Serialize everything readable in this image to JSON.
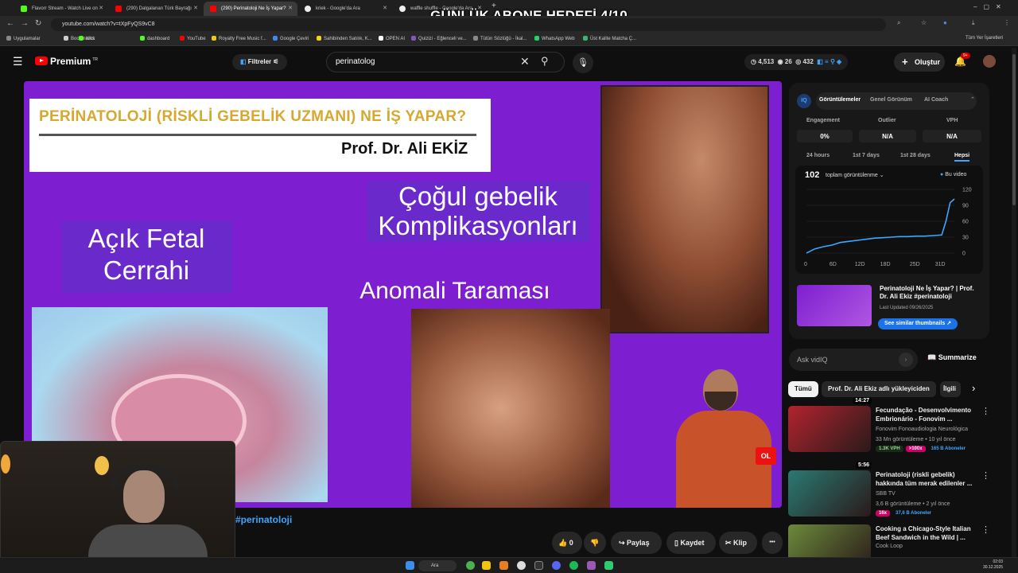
{
  "overlay": {
    "title": "GÜNLÜK ABONE HEDEFİ 4/10"
  },
  "browser": {
    "tabs": [
      {
        "label": "Flavorr Stream - Watch Live on",
        "color": "#53fc18"
      },
      {
        "label": "(290) Dalgalanan Türk Bayrağı",
        "color": "#ff0000"
      },
      {
        "label": "(290) Perinatoloji Ne İş Yapar?",
        "color": "#ff0000"
      },
      {
        "label": "kriek - Google'da Ara",
        "color": "#ffffff"
      },
      {
        "label": "waffle shuffle - Google'da Ara",
        "color": "#ffffff"
      }
    ],
    "new_tab": "+",
    "url": "youtube.com/watch?v=tXpFyQS9vC8",
    "bookmarks": [
      {
        "label": "Uygulamalar",
        "color": "#888888"
      },
      {
        "label": "Bookmarks",
        "color": "#cccccc"
      },
      {
        "label": "Kick",
        "color": "#53fc18"
      },
      {
        "label": "dashboard",
        "color": "#53fc18"
      },
      {
        "label": "YouTube",
        "color": "#ff0000"
      },
      {
        "label": "Royalty Free Music f...",
        "color": "#f5c518"
      },
      {
        "label": "Google Çeviri",
        "color": "#4285f4"
      },
      {
        "label": "Sahibinden Satılık, K...",
        "color": "#f5d60a"
      },
      {
        "label": "OPEN AI",
        "color": "#ffffff"
      },
      {
        "label": "Quizizi - Eğlenceli ve...",
        "color": "#8854c0"
      },
      {
        "label": "Tütün Sözlüğü - İkal...",
        "color": "#888888"
      },
      {
        "label": "WhatsApp Web",
        "color": "#25d366"
      },
      {
        "label": "Üst Kalite Matcha Ç...",
        "color": "#3cb371"
      }
    ],
    "other_bookmarks": "Tüm Yer İşaretleri"
  },
  "youtube": {
    "logo": "Premium",
    "logo_sup": "TR",
    "filters": "Filtreler",
    "search_value": "perinatolog",
    "stats": {
      "a": "4,513",
      "b": "26",
      "c": "432"
    },
    "create": "Oluştur",
    "notif_count": "9+"
  },
  "video": {
    "title_line1": "PERİNATOLOJİ (RİSKLİ GEBELİK UZMANI) NE İŞ YAPAR?",
    "title_line2": "Prof. Dr. Ali EKİZ",
    "label_fetal": "Açık Fetal\nCerrahi",
    "label_cogul": "Çoğul gebelik\nKomplikasyonları",
    "label_anomali": "Anomali Taraması",
    "abone_badge": "OL",
    "hashtag_link": "#perinatoloji",
    "actions": {
      "likes": "0",
      "share": "Paylaş",
      "save": "Kaydet",
      "clip": "Klip",
      "more": "•••"
    }
  },
  "vidiq": {
    "tabs": [
      "Görüntülemeler",
      "Genel Görünüm",
      "AI Coach"
    ],
    "metrics": [
      {
        "label": "Engagement",
        "value": "0%"
      },
      {
        "label": "Outlier",
        "value": "N/A"
      },
      {
        "label": "VPH",
        "value": "N/A"
      }
    ],
    "ranges": [
      "24 hours",
      "1st 7 days",
      "1st 28 days",
      "Hepsi"
    ],
    "views": "102",
    "views_select": "toplam görüntülenme",
    "legend": "Bu video",
    "rec_title": "Perinatoloji Ne İş Yapar? | Prof. Dr. Ali Ekiz #perinatoloji",
    "rec_updated": "Last Updated 09/26/2025",
    "similar_button": "See similar thumbnails",
    "ask_placeholder": "Ask vidIQ",
    "summarize": "Summarize",
    "accent": "#3ea6ff"
  },
  "chart_data": {
    "type": "line",
    "x": [
      0,
      2,
      4,
      6,
      8,
      10,
      12,
      14,
      16,
      18,
      20,
      22,
      24,
      26,
      28,
      30,
      32,
      33,
      34,
      35
    ],
    "x_unit": "days",
    "xticks": [
      "0",
      "6D",
      "12D",
      "18D",
      "25D",
      "31D"
    ],
    "yticks": [
      "0",
      "30",
      "60",
      "90",
      "120"
    ],
    "ylim": [
      0,
      120
    ],
    "series": [
      {
        "name": "Bu video",
        "values": [
          0,
          8,
          12,
          15,
          20,
          22,
          24,
          26,
          28,
          29,
          30,
          31,
          31,
          32,
          32,
          33,
          34,
          60,
          95,
          102
        ]
      }
    ]
  },
  "chips": [
    "Tümü",
    "Prof. Dr. Ali Ekiz adlı yükleyiciden",
    "İlgili"
  ],
  "recommendations": [
    {
      "title": "Fecundação - Desenvolvimento Embrionário - Fonovim ...",
      "channel": "Fonovim Fonoaudiologia Neurológica",
      "meta": "33 Mn görüntüleme • 10 yıl önce",
      "duration": "14:27",
      "badges": [
        {
          "text": "1.3K VPH",
          "bg": "#1a2a1a",
          "fg": "#8fd18f"
        },
        {
          "text": ">100x",
          "bg": "#cc0066",
          "fg": "#ffffff"
        },
        {
          "text": "165 B Aboneler",
          "bg": "transparent",
          "fg": "#3ea6ff"
        }
      ],
      "color": "#b3232f"
    },
    {
      "title": "Perinatoloji (riskli gebelik) hakkında tüm merak edilenler ...",
      "channel": "SBB TV",
      "meta": "3,6 B görüntüleme • 2 yıl önce",
      "duration": "5:56",
      "badges": [
        {
          "text": "16x",
          "bg": "#cc0066",
          "fg": "#ffffff"
        },
        {
          "text": "37,6 B Aboneler",
          "bg": "transparent",
          "fg": "#3ea6ff"
        }
      ],
      "color": "#2a7a73"
    },
    {
      "title": "Cooking a Chicago-Style Italian Beef Sandwich in the Wild | ...",
      "channel": "Cook Loop",
      "meta": "",
      "duration": "",
      "badges": [],
      "color": "#6b8a3a"
    }
  ],
  "taskbar": {
    "search": "Ara",
    "time": "02:03",
    "date": "30.12.2025"
  }
}
